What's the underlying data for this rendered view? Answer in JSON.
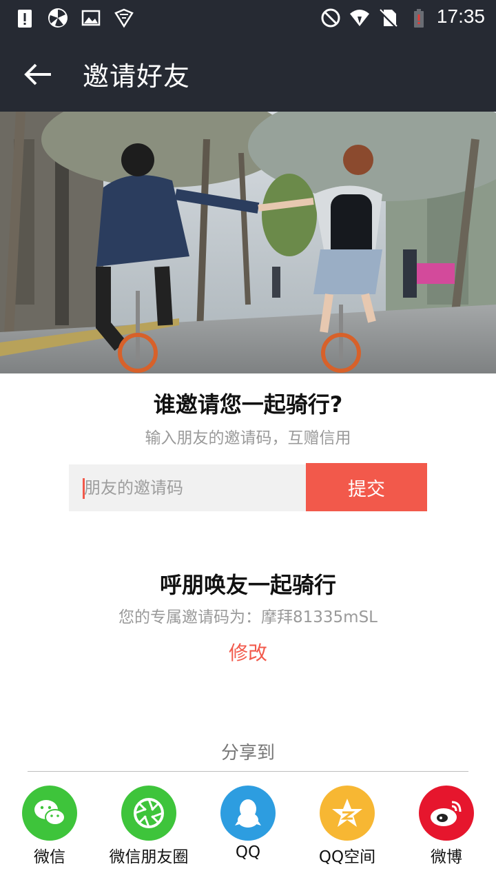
{
  "status_bar": {
    "time": "17:35",
    "icons": [
      "alert-icon",
      "vpn-icon",
      "image-icon",
      "shield-icon",
      "block-icon",
      "wifi-icon",
      "no-sim-icon",
      "battery-icon"
    ]
  },
  "app_bar": {
    "title": "邀请好友",
    "back_icon": "arrow-left-icon"
  },
  "invite": {
    "title": "谁邀请您一起骑行?",
    "subtitle": "输入朋友的邀请码，互赠信用",
    "input_placeholder": "朋友的邀请码",
    "input_value": "",
    "submit_label": "提交"
  },
  "my_code": {
    "title": "呼朋唤友一起骑行",
    "code_text": "您的专属邀请码为：摩拜81335mSL",
    "modify_label": "修改"
  },
  "share": {
    "label": "分享到",
    "items": [
      {
        "label": "微信",
        "icon": "wechat-icon",
        "color": "#3ec43b"
      },
      {
        "label": "微信朋友圈",
        "icon": "moments-icon",
        "color": "#3ec43b"
      },
      {
        "label": "QQ",
        "icon": "qq-icon",
        "color": "#2d9de0"
      },
      {
        "label": "QQ空间",
        "icon": "qzone-icon",
        "color": "#f7b733"
      },
      {
        "label": "微博",
        "icon": "weibo-icon",
        "color": "#e6162d"
      }
    ]
  },
  "colors": {
    "header_bg": "#262a33",
    "accent": "#f2594b"
  }
}
